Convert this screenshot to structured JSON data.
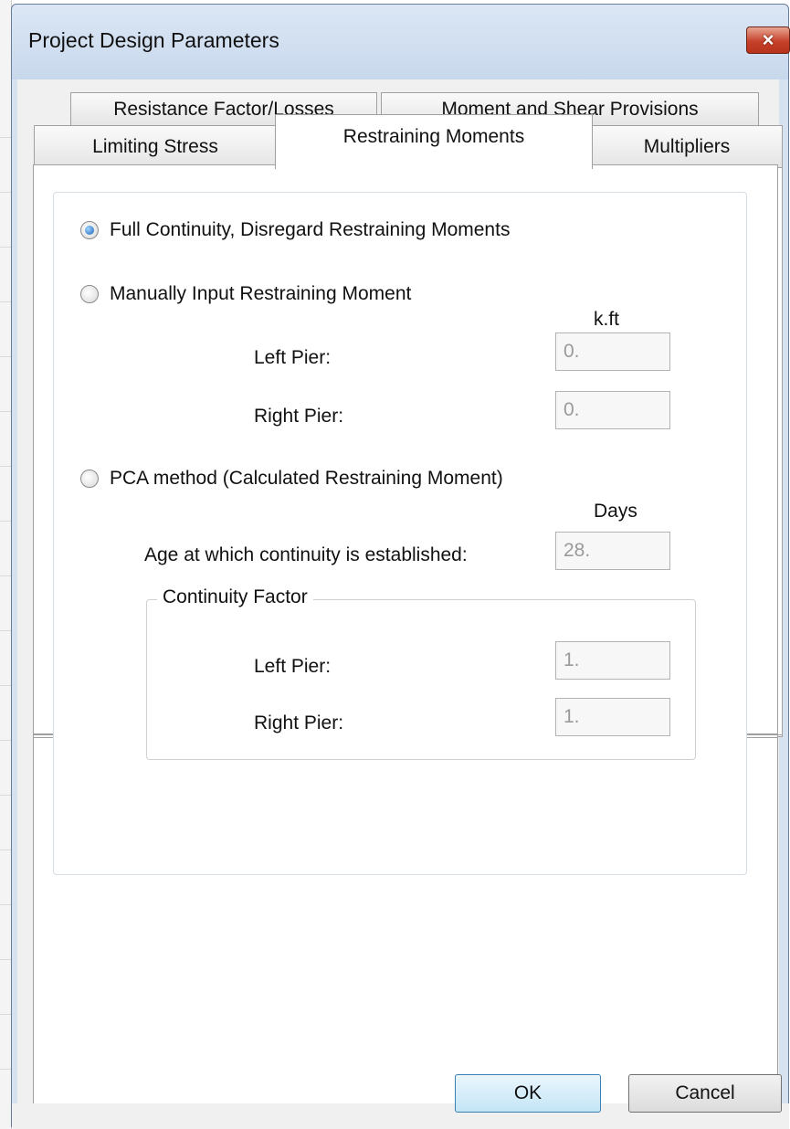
{
  "window": {
    "title": "Project Design Parameters",
    "close_symbol": "×"
  },
  "tabs": {
    "row1": [
      {
        "label": "Resistance Factor/Losses"
      },
      {
        "label": "Moment and Shear Provisions"
      }
    ],
    "row2": [
      {
        "label": "Limiting Stress"
      },
      {
        "label": "Restraining Moments",
        "active": true
      },
      {
        "label": "Multipliers"
      }
    ]
  },
  "options": {
    "full_continuity": {
      "label": "Full Continuity, Disregard Restraining Moments",
      "selected": true
    },
    "manual": {
      "label": "Manually Input Restraining Moment",
      "selected": false
    },
    "pca": {
      "label": "PCA method (Calculated Restraining Moment)",
      "selected": false
    }
  },
  "manual": {
    "unit": "k.ft",
    "left_pier": {
      "label": "Left Pier:",
      "value": "0."
    },
    "right_pier": {
      "label": "Right Pier:",
      "value": "0."
    }
  },
  "pca": {
    "unit": "Days",
    "age": {
      "label": "Age at which continuity is established:",
      "value": "28."
    },
    "continuity_factor": {
      "legend": "Continuity Factor",
      "left_pier": {
        "label": "Left Pier:",
        "value": "1."
      },
      "right_pier": {
        "label": "Right Pier:",
        "value": "1."
      }
    }
  },
  "buttons": {
    "ok": "OK",
    "cancel": "Cancel"
  }
}
